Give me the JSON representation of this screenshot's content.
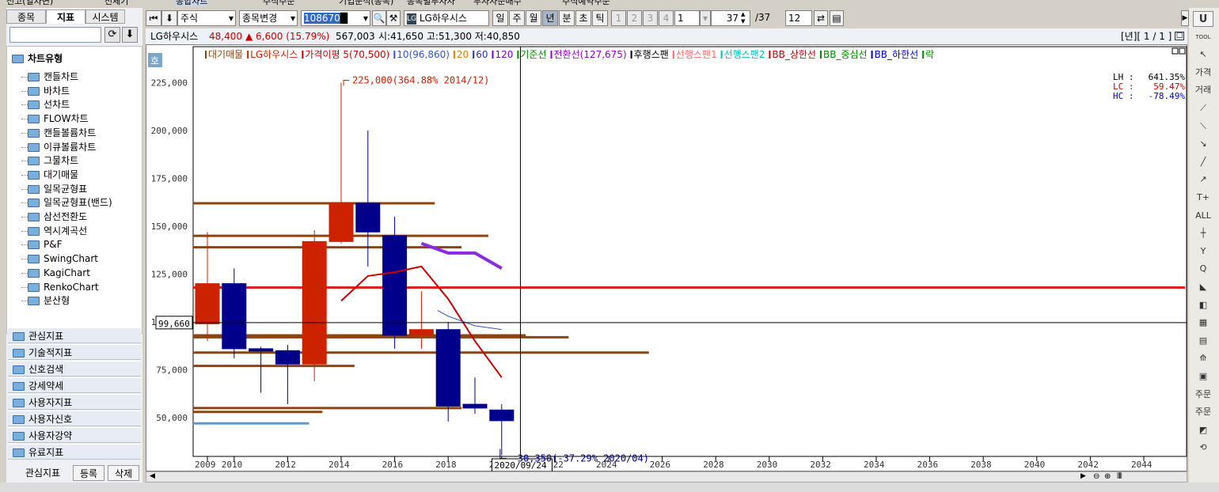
{
  "top_tabs": [
    "전고(일차변)",
    "전체기",
    "종합차트",
    "주식주문",
    "기업분석(종목)",
    "종목별투자자",
    "투자자순매수",
    "주식예약주문"
  ],
  "left_panel": {
    "tabs": [
      "종목",
      "지표",
      "시스템"
    ],
    "tree_root": "차트유형",
    "tree_items": [
      "캔들차트",
      "바차트",
      "선차트",
      "FLOW차트",
      "캔들볼륨차트",
      "이큐볼륨차트",
      "그물차트",
      "대기매물",
      "일목균형표",
      "일목균형표(밴드)",
      "삼선전환도",
      "역시계곡선",
      "P&F",
      "SwingChart",
      "KagiChart",
      "RenkoChart",
      "분산형"
    ],
    "categories": [
      "관심지표",
      "기술적지표",
      "신호검색",
      "강세약세",
      "사용자지표",
      "사용자신호",
      "사용자강약",
      "유료지표"
    ],
    "bottom_label": "관심지표",
    "bottom_buttons": [
      "등록",
      "삭제"
    ]
  },
  "toolbar": {
    "market": "주식",
    "change": "종목변경",
    "code": "108670",
    "stock_name": "LG하우시스",
    "periods": [
      "일",
      "주",
      "월",
      "년",
      "분",
      "초",
      "틱"
    ],
    "period_active": "년",
    "nums": [
      "1",
      "2",
      "3",
      "4"
    ],
    "num_select": "1",
    "count": "37",
    "count_total": "/37",
    "view": "12"
  },
  "info": {
    "name": "LG하우시스",
    "price": "48,400",
    "change": "▲ 6,600 (15.79%)",
    "volume": "567,003",
    "ohl": "시:41,650 고:51,300 저:40,850",
    "page": "[년][ 1 / 1 ]"
  },
  "legend": [
    {
      "t": "대기매물",
      "c": "#8b4513"
    },
    {
      "t": "LG하우시스",
      "c": "#cc2200"
    },
    {
      "t": "가격이평  5(70,500)",
      "c": "#cc0000"
    },
    {
      "t": "10(96,860)",
      "c": "#3355cc"
    },
    {
      "t": "20",
      "c": "#e08000"
    },
    {
      "t": "60",
      "c": "#2233aa"
    },
    {
      "t": "120",
      "c": "#7700cc"
    },
    {
      "t": "기준선",
      "c": "#008800"
    },
    {
      "t": "전환선(127,675)",
      "c": "#9900cc"
    },
    {
      "t": "후행스팬",
      "c": "#000000"
    },
    {
      "t": "선행스팬1",
      "c": "#ff6666"
    },
    {
      "t": "선행스팬2",
      "c": "#00bbbb"
    },
    {
      "t": "BB_상한선",
      "c": "#cc0000"
    },
    {
      "t": "BB_중심선",
      "c": "#008800"
    },
    {
      "t": "BB_하한선",
      "c": "#0000cc"
    },
    {
      "t": "락",
      "c": "#008800"
    }
  ],
  "stats": [
    {
      "k": "LH :",
      "v": "641.35%",
      "c": "#000000"
    },
    {
      "k": "LC :",
      "v": "59.47%",
      "c": "#cc0000"
    },
    {
      "k": "HC :",
      "v": "-78.49%",
      "c": "#0000cc"
    }
  ],
  "annotations": {
    "high": "225,000(364.88% 2014/12)",
    "low": "30,350(-37.29% 2020/04)",
    "cursor_price": "99,660",
    "cursor_date": "2020/09/24",
    "ho": "호"
  },
  "right_toolbar": [
    "U",
    "TOOL",
    "↖",
    "가격",
    "거래",
    "⟋",
    "⟍",
    "↘",
    "╱",
    "↗",
    "T+",
    "ALL",
    "┼",
    "Y",
    "Q",
    "◣",
    "◧",
    "▦",
    "▤",
    "⟰",
    "▣",
    "주문",
    "주문",
    "◩",
    "⟲"
  ],
  "chart_data": {
    "type": "candlestick",
    "period": "year",
    "ylim": [
      20000,
      240000
    ],
    "y_ticks": [
      50000,
      75000,
      100000,
      125000,
      150000,
      175000,
      200000,
      225000
    ],
    "y_tick_labels": [
      "50,000",
      "75,000",
      "100,000",
      "125,000",
      "150,000",
      "175,000",
      "200,000",
      "225,000"
    ],
    "x_tick_labels": [
      "2009",
      "2010",
      "2012",
      "2014",
      "2016",
      "2018",
      "2020",
      "2022",
      "2024",
      "2026",
      "2028",
      "2030",
      "2032",
      "2034",
      "2036",
      "2038",
      "2040",
      "2042",
      "2044"
    ],
    "candles": [
      {
        "year": 2009,
        "open": 99000,
        "close": 120000,
        "high": 147000,
        "low": 90000
      },
      {
        "year": 2010,
        "open": 120000,
        "close": 86000,
        "high": 128000,
        "low": 81000
      },
      {
        "year": 2011,
        "open": 86000,
        "close": 85000,
        "high": 87000,
        "low": 63000
      },
      {
        "year": 2012,
        "open": 85000,
        "close": 78000,
        "high": 88000,
        "low": 57000
      },
      {
        "year": 2013,
        "open": 78000,
        "close": 142000,
        "high": 148000,
        "low": 69000
      },
      {
        "year": 2014,
        "open": 142000,
        "close": 162000,
        "high": 225000,
        "low": 141000
      },
      {
        "year": 2015,
        "open": 162000,
        "close": 147000,
        "high": 200000,
        "low": 129000
      },
      {
        "year": 2016,
        "open": 145000,
        "close": 93000,
        "high": 155000,
        "low": 86000
      },
      {
        "year": 2017,
        "open": 93000,
        "close": 96000,
        "high": 116000,
        "low": 86000
      },
      {
        "year": 2018,
        "open": 96000,
        "close": 56000,
        "high": 100000,
        "low": 48000
      },
      {
        "year": 2019,
        "open": 57000,
        "close": 55000,
        "high": 71000,
        "low": 52000
      },
      {
        "year": 2020,
        "open": 54000,
        "close": 48400,
        "high": 57000,
        "low": 30350
      }
    ],
    "ma5": [
      [
        2014,
        111000
      ],
      [
        2015,
        124000
      ],
      [
        2016,
        126000
      ],
      [
        2017,
        129000
      ],
      [
        2018,
        112000
      ],
      [
        2019,
        90000
      ],
      [
        2020,
        71000
      ]
    ],
    "ma10": [
      [
        2017.6,
        106000
      ],
      [
        2018,
        103000
      ],
      [
        2019,
        98000
      ],
      [
        2020,
        96000
      ]
    ],
    "tenkan": [
      [
        2017,
        141000
      ],
      [
        2018,
        136000
      ],
      [
        2019,
        136000
      ],
      [
        2020,
        128000
      ]
    ],
    "h_line": 118000,
    "volume_profile": [
      {
        "price": 162000,
        "to_year": 2017.5
      },
      {
        "price": 145000,
        "to_year": 2019.5
      },
      {
        "price": 139000,
        "to_year": 2018.5
      },
      {
        "price": 92000,
        "to_year": 2022.5
      },
      {
        "price": 93000,
        "to_year": 2020.9
      },
      {
        "price": 84000,
        "to_year": 2025.5
      },
      {
        "price": 77000,
        "to_year": 2014.5
      },
      {
        "price": 55000,
        "to_year": 2018.5
      },
      {
        "price": 53000,
        "to_year": 2013.3
      }
    ],
    "blue_level": {
      "price": 47000,
      "to_year": 2012.8
    },
    "cursor": {
      "year": 2020.7,
      "price": 99660
    }
  }
}
